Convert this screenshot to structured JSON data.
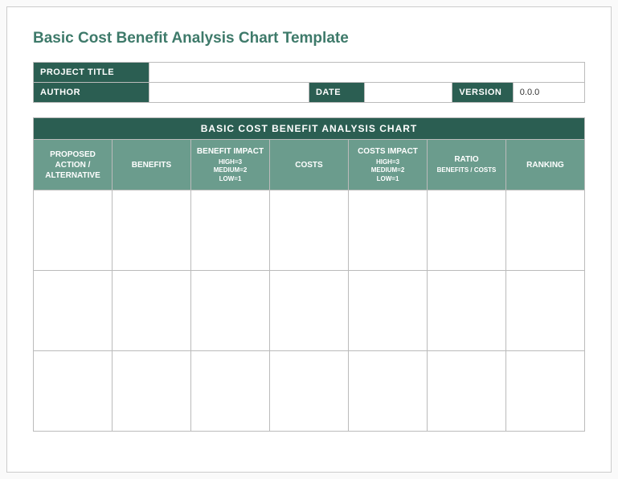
{
  "title": "Basic Cost Benefit Analysis Chart Template",
  "meta": {
    "project_title_label": "PROJECT TITLE",
    "project_title_value": "",
    "author_label": "AUTHOR",
    "author_value": "",
    "date_label": "DATE",
    "date_value": "",
    "version_label": "VERSION",
    "version_value": "0.0.0"
  },
  "chart": {
    "heading": "BASIC COST BENEFIT ANALYSIS CHART",
    "columns": {
      "action": "PROPOSED ACTION / ALTERNATIVE",
      "benefits": "BENEFITS",
      "benefit_impact": "BENEFIT IMPACT",
      "benefit_impact_sub": "HIGH=3\nMEDIUM=2\nLOW=1",
      "costs": "COSTS",
      "costs_impact": "COSTS IMPACT",
      "costs_impact_sub": "HIGH=3\nMEDIUM=2\nLOW=1",
      "ratio": "RATIO",
      "ratio_sub": "BENEFITS / COSTS",
      "ranking": "RANKING"
    },
    "rows": [
      {
        "action": "",
        "benefits": "",
        "benefit_impact": "",
        "costs": "",
        "costs_impact": "",
        "ratio": "",
        "ranking": ""
      },
      {
        "action": "",
        "benefits": "",
        "benefit_impact": "",
        "costs": "",
        "costs_impact": "",
        "ratio": "",
        "ranking": ""
      },
      {
        "action": "",
        "benefits": "",
        "benefit_impact": "",
        "costs": "",
        "costs_impact": "",
        "ratio": "",
        "ranking": ""
      }
    ]
  }
}
